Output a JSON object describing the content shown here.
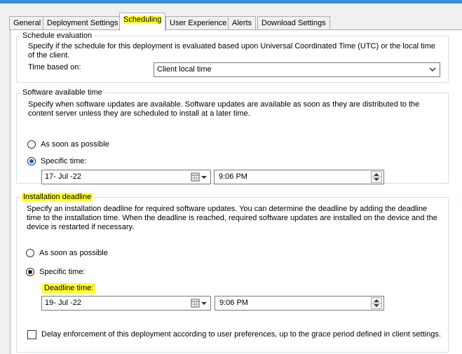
{
  "tabs": [
    {
      "label": "General"
    },
    {
      "label": "Deployment Settings"
    },
    {
      "label": "Scheduling"
    },
    {
      "label": "User Experience"
    },
    {
      "label": "Alerts"
    },
    {
      "label": "Download Settings"
    }
  ],
  "schedule_evaluation": {
    "legend": "Schedule evaluation",
    "description": "Specify if the schedule for this deployment is evaluated based upon Universal Coordinated Time (UTC) or the local time of the client.",
    "time_based_on_label": "Time based on:",
    "time_based_on_value": "Client local time"
  },
  "software_available": {
    "legend": "Software available time",
    "description": "Specify when software updates are available. Software updates are available as soon as they are distributed to the content server unless they are scheduled to install at a later time.",
    "asap_label": "As soon as possible",
    "specific_label": "Specific time:",
    "date": "17- Jul -22",
    "time": "9:06 PM"
  },
  "installation_deadline": {
    "legend": "Installation deadline",
    "description": "Specify an installation deadline for required software updates. You can determine the deadline by adding the deadline time to the installation time. When the deadline is reached, required software updates are installed on the device and the device is restarted if necessary.",
    "asap_label": "As soon as possible",
    "specific_label": "Specific time:",
    "deadline_label": "Deadline time:",
    "date": "19- Jul -22",
    "time": "9:06 PM"
  },
  "delay_enforcement_label": "Delay enforcement of this deployment according to user preferences, up to the grace period defined in client settings.",
  "colors": {
    "highlight": "#ffff33",
    "title_bar": "#3b8fd6",
    "radio_selected": "#1a5fb4"
  }
}
